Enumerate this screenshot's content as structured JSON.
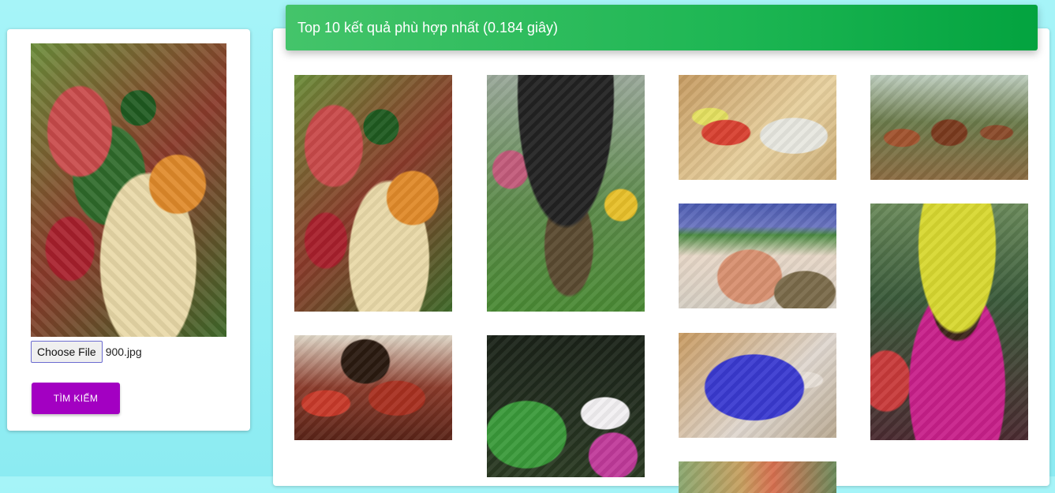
{
  "sidebar": {
    "query_image_alt": "query image",
    "file_button_label": "Choose File",
    "file_name": "900.jpg",
    "search_button_label": "TÌM KIẾM"
  },
  "results": {
    "header_text": "Top 10 kết quả phù hợp nhất (0.184 giây)",
    "header_colors": [
      "#44c46a",
      "#03a33f"
    ],
    "items": [
      {
        "subject": "food-platter"
      },
      {
        "subject": "tribal-man-umbrella"
      },
      {
        "subject": "salad-bowls"
      },
      {
        "subject": "tribal-dancers"
      },
      {
        "subject": "beach-sunbathers"
      },
      {
        "subject": "woman-banana-headdress"
      },
      {
        "subject": "painted-tribesmen"
      },
      {
        "subject": "watermelon-flowers"
      },
      {
        "subject": "fish-dinner-plate"
      },
      {
        "subject": "partial-tribal-image"
      }
    ]
  },
  "colors": {
    "background": "#a6f4f8",
    "search_button": "#a300c2"
  }
}
